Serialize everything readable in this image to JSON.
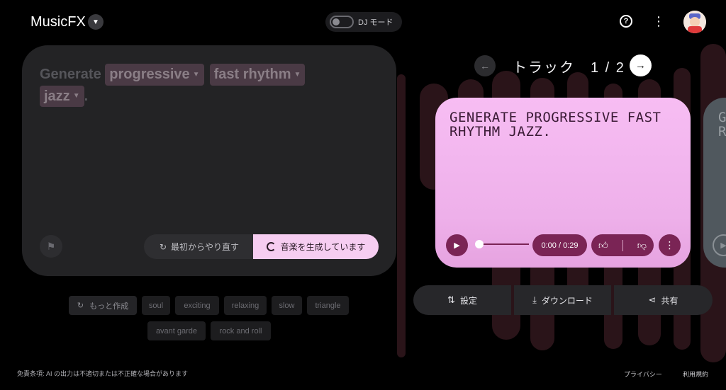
{
  "header": {
    "brand": "MusicFX",
    "dj_mode_label": "DJ モード"
  },
  "prompt": {
    "lead": "Generate",
    "chips": [
      "progressive",
      "fast rhythm",
      "jazz"
    ],
    "trail": ".",
    "restart_label": "最初からやり直す",
    "generate_label": "音楽を生成しています"
  },
  "suggestions": {
    "more_label": "もっと作成",
    "chips": [
      "soul",
      "exciting",
      "relaxing",
      "slow",
      "triangle",
      "avant garde",
      "rock and roll"
    ]
  },
  "track": {
    "nav_label": "トラック　1 / 2",
    "title": "GENERATE PROGRESSIVE FAST RHYTHM JAZZ.",
    "time": "0:00 / 0:29",
    "progress": 0,
    "peek_text": "G R"
  },
  "actions": {
    "settings": "設定",
    "download": "ダウンロード",
    "share": "共有"
  },
  "footer": {
    "disclaimer": "免責条項: AI の出力は不適切または不正確な場合があります",
    "privacy": "プライバシー",
    "terms": "利用規約"
  },
  "colors": {
    "accent_pink": "#f6cdf1",
    "player_control": "#7a2455",
    "background": "#000000"
  }
}
